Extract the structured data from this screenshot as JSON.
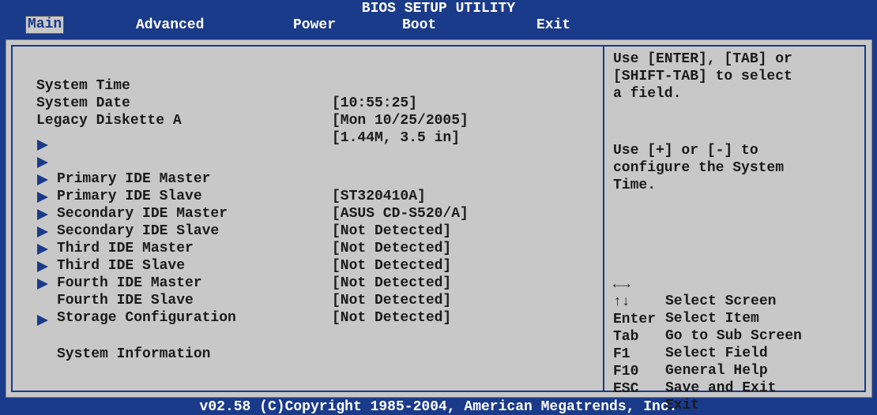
{
  "title": "BIOS SETUP UTILITY",
  "menu": [
    "Main",
    "Advanced",
    "Power",
    "Boot",
    "Exit"
  ],
  "main": {
    "system_time": {
      "label": "System Time",
      "value": "[10:55:25]"
    },
    "system_date": {
      "label": "System Date",
      "value": "[Mon 10/25/2005]"
    },
    "legacy_diskette": {
      "label": "Legacy Diskette A",
      "value": "[1.44M, 3.5 in]"
    },
    "ide": [
      {
        "label": "Primary IDE Master",
        "value": "[ST320410A]"
      },
      {
        "label": "Primary IDE Slave",
        "value": "[ASUS CD-S520/A]"
      },
      {
        "label": "Secondary IDE Master",
        "value": "[Not Detected]"
      },
      {
        "label": "Secondary IDE Slave",
        "value": "[Not Detected]"
      },
      {
        "label": "Third IDE Master",
        "value": "[Not Detected]"
      },
      {
        "label": "Third IDE Slave",
        "value": "[Not Detected]"
      },
      {
        "label": "Fourth IDE Master",
        "value": "[Not Detected]"
      },
      {
        "label": "Fourth IDE Slave",
        "value": "[Not Detected]"
      }
    ],
    "storage_configuration": "Storage Configuration",
    "system_information": "System Information"
  },
  "help": {
    "line1": "Use [ENTER], [TAB] or",
    "line2": "[SHIFT-TAB] to select",
    "line3": "a field.",
    "line4": "Use [+] or [-] to",
    "line5": "configure the System",
    "line6": "Time."
  },
  "keys": [
    {
      "key": "←→",
      "desc": "Select Screen"
    },
    {
      "key": "↑↓",
      "desc": "Select Item"
    },
    {
      "key": "Enter",
      "desc": "Go to Sub Screen"
    },
    {
      "key": "Tab",
      "desc": "Select Field"
    },
    {
      "key": "F1",
      "desc": "General Help"
    },
    {
      "key": "F10",
      "desc": "Save and Exit"
    },
    {
      "key": "ESC",
      "desc": "Exit"
    }
  ],
  "footer": "v02.58 (C)Copyright 1985-2004, American Megatrends, Inc."
}
